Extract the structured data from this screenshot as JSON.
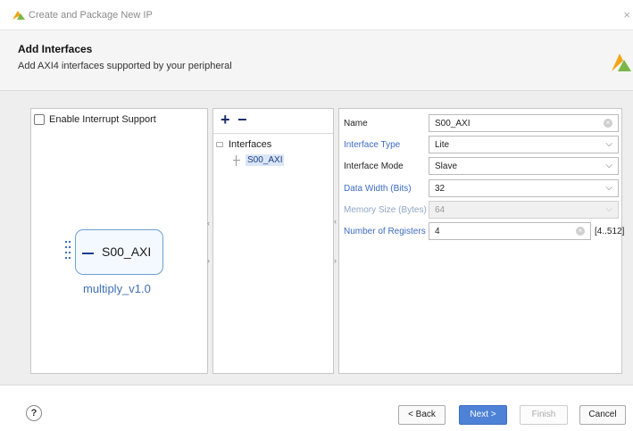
{
  "window": {
    "title": "Create and Package New IP",
    "close_glyph": "×",
    "app_icon": "vivado-leaf-icon"
  },
  "header": {
    "title": "Add Interfaces",
    "subtitle": "Add AXI4 interfaces supported by your peripheral",
    "logo": "vivado-logo-icon"
  },
  "left_panel": {
    "interrupt_label": "Enable Interrupt Support",
    "interrupt_checked": false,
    "block_port_label": "S00_AXI",
    "block_name": "multiply_v1.0"
  },
  "mid_panel": {
    "add_glyph": "+",
    "remove_glyph": "−",
    "tree_root": "Interfaces",
    "tree_child": "S00_AXI"
  },
  "properties": {
    "name": {
      "label": "Name",
      "value": "S00_AXI"
    },
    "interface_type": {
      "label": "Interface Type",
      "value": "Lite"
    },
    "interface_mode": {
      "label": "Interface Mode",
      "value": "Slave"
    },
    "data_width": {
      "label": "Data Width (Bits)",
      "value": "32"
    },
    "memory_size": {
      "label": "Memory Size (Bytes)",
      "value": "64"
    },
    "num_registers": {
      "label": "Number of Registers",
      "value": "4",
      "range": "[4..512]"
    }
  },
  "glyphs": {
    "chevron": "⌵",
    "clear": "×",
    "arrow_left": "‹",
    "arrow_right": "›"
  },
  "footer": {
    "help": "?",
    "back": "< Back",
    "next": "Next >",
    "finish": "Finish",
    "cancel": "Cancel"
  },
  "colors": {
    "accent_blue": "#3d6bc6",
    "next_button": "#4e82d6",
    "block_name": "#3f6fb6"
  }
}
